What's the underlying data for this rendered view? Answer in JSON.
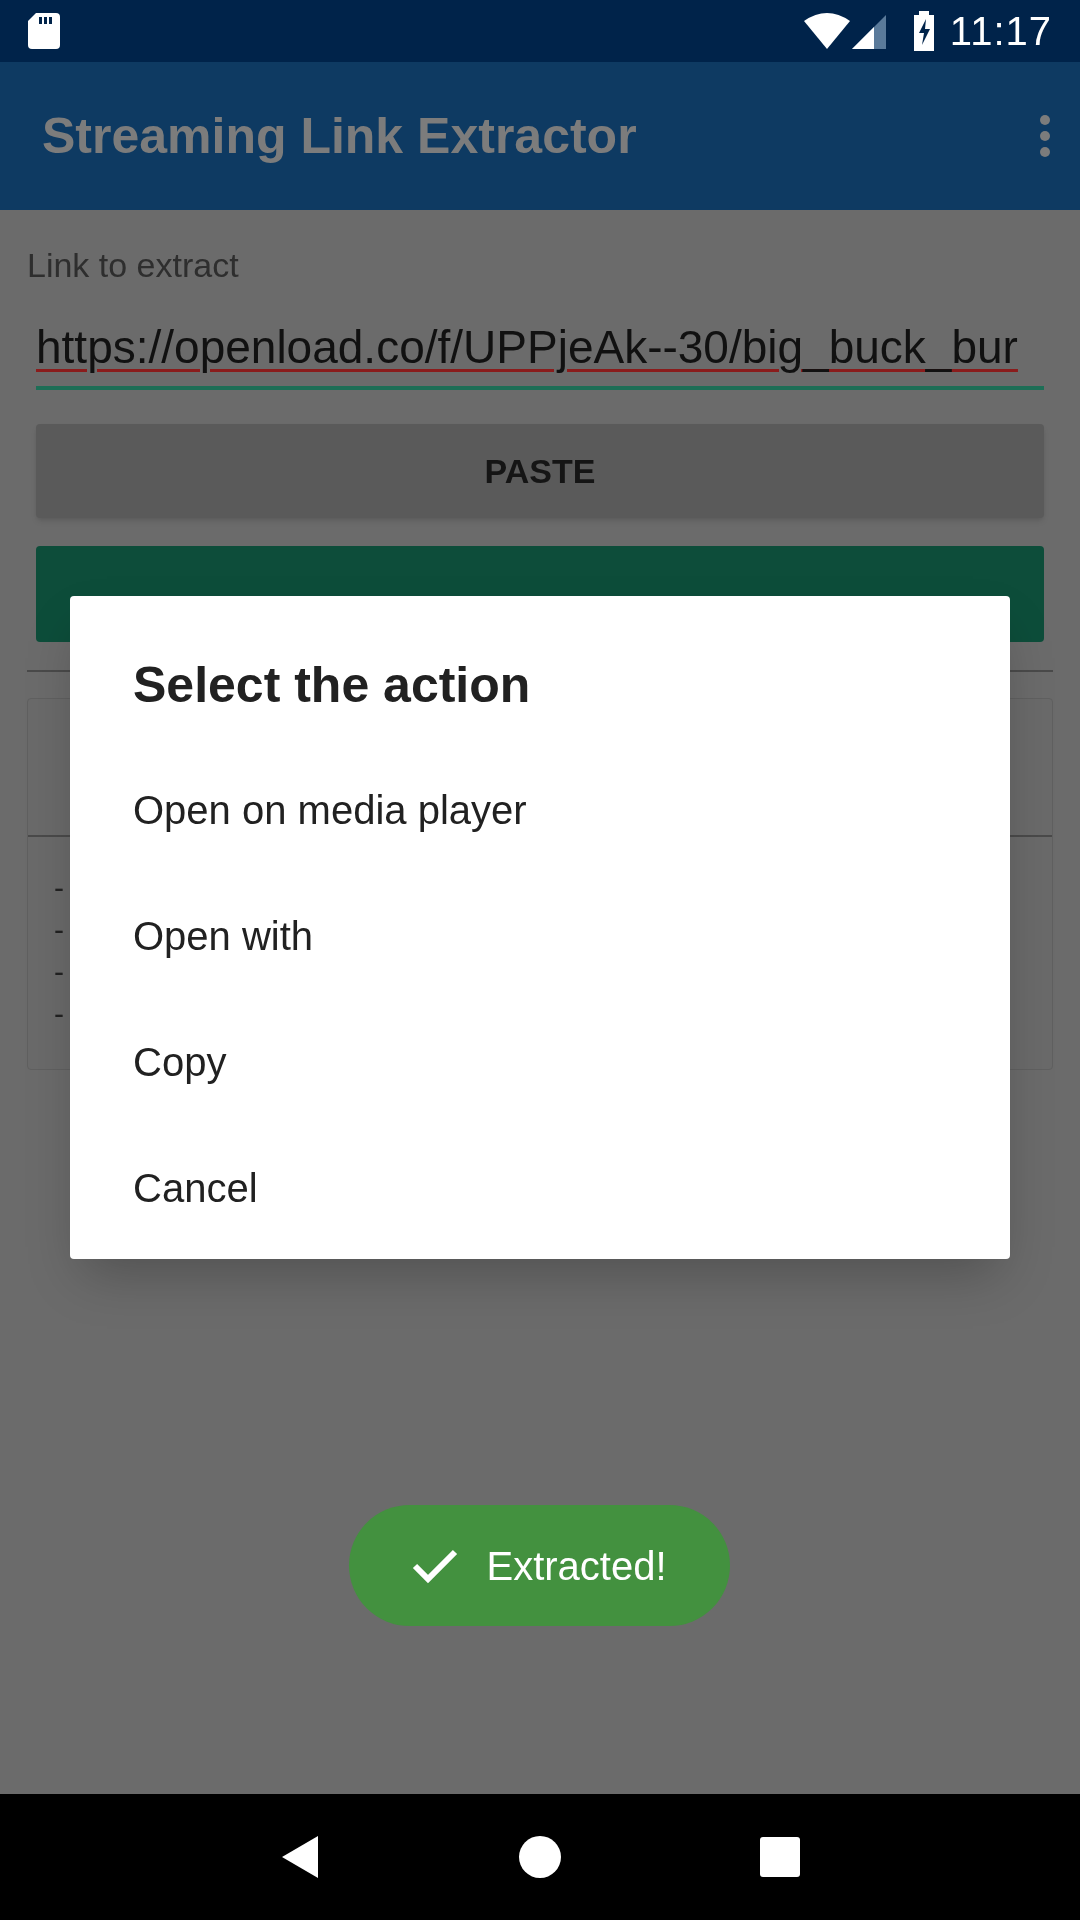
{
  "status_bar": {
    "time": "11:17"
  },
  "app_bar": {
    "title": "Streaming Link Extractor"
  },
  "form": {
    "label": "Link to extract",
    "value": "https://openload.co/f/UPPjeAk--30/big_buck_bur",
    "paste_button": "PASTE"
  },
  "card": {
    "lines": [
      "-",
      "-",
      "-",
      "-"
    ]
  },
  "dialog": {
    "title": "Select the action",
    "items": [
      "Open on media player",
      "Open with",
      "Copy",
      "Cancel"
    ]
  },
  "toast": {
    "text": "Extracted!"
  }
}
